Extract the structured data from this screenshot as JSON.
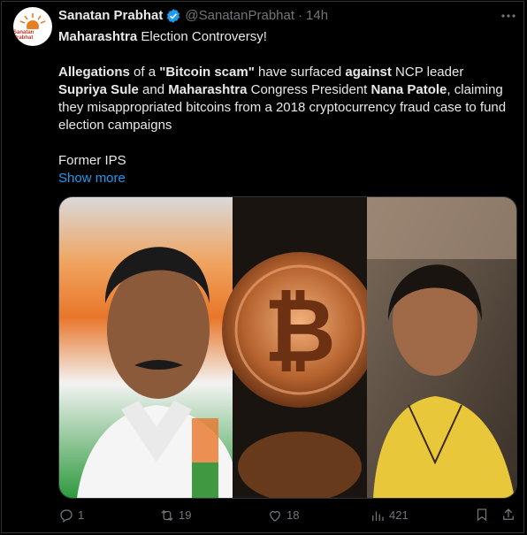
{
  "tweet": {
    "author_name": "Sanatan Prabhat",
    "handle": "@SanatanPrabhat",
    "separator": "·",
    "time": "14h",
    "avatar_text": "Sanatan Prabhat",
    "more_icon": "more-horizontal-icon",
    "verified_icon": "verified-badge-icon",
    "p1": [
      {
        "text": "Maharashtra",
        "bold": true
      },
      {
        "text": " Election Controversy!",
        "bold": false
      }
    ],
    "p2": [
      {
        "text": "Allegations",
        "bold": true
      },
      {
        "text": " of a ",
        "bold": false
      },
      {
        "text": "\"Bitcoin scam\"",
        "bold": true
      },
      {
        "text": " have surfaced ",
        "bold": false
      },
      {
        "text": "against",
        "bold": true
      },
      {
        "text": " NCP leader ",
        "bold": false
      },
      {
        "text": "Supriya Sule",
        "bold": true
      },
      {
        "text": " and ",
        "bold": false
      },
      {
        "text": "Maharashtra",
        "bold": true
      },
      {
        "text": " Congress President ",
        "bold": false
      },
      {
        "text": "Nana Patole",
        "bold": true
      },
      {
        "text": ", claiming they misappropriated bitcoins from a 2018 cryptocurrency fraud case to fund election campaigns",
        "bold": false
      }
    ],
    "p3": "Former IPS",
    "show_more": "Show more",
    "media_panels": [
      "politician-left-photo",
      "bitcoin-coin-photo",
      "politician-right-photo"
    ],
    "actions": {
      "replies": "1",
      "reposts": "19",
      "likes": "18",
      "views": "421"
    },
    "colors": {
      "accent": "#1d9bf0",
      "muted": "#71767b",
      "text": "#e7e9ea",
      "background": "#000000"
    }
  }
}
